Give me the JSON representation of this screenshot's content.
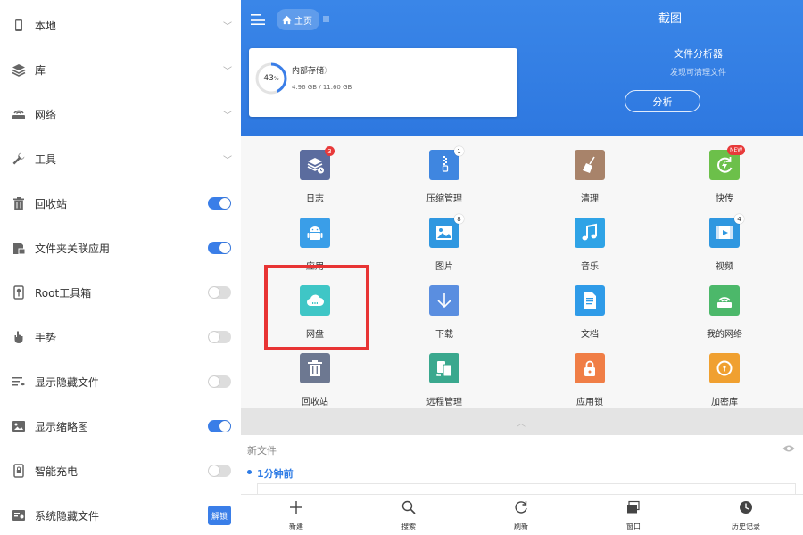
{
  "sidebar": {
    "items": [
      {
        "label": "本地",
        "icon": "phone-icon",
        "control": "chevron"
      },
      {
        "label": "库",
        "icon": "layers-icon",
        "control": "chevron"
      },
      {
        "label": "网络",
        "icon": "router-icon",
        "control": "chevron"
      },
      {
        "label": "工具",
        "icon": "wrench-icon",
        "control": "chevron"
      },
      {
        "label": "回收站",
        "icon": "trash-icon",
        "control": "toggle",
        "on": true
      },
      {
        "label": "文件夹关联应用",
        "icon": "folder-app-icon",
        "control": "toggle",
        "on": true
      },
      {
        "label": "Root工具箱",
        "icon": "root-icon",
        "control": "toggle",
        "on": false
      },
      {
        "label": "手势",
        "icon": "hand-icon",
        "control": "toggle",
        "on": false
      },
      {
        "label": "显示隐藏文件",
        "icon": "hidden-list-icon",
        "control": "toggle",
        "on": false
      },
      {
        "label": "显示缩略图",
        "icon": "thumbnail-icon",
        "control": "toggle",
        "on": true
      },
      {
        "label": "智能充电",
        "icon": "battery-lock-icon",
        "control": "toggle",
        "on": false
      },
      {
        "label": "系统隐藏文件",
        "icon": "system-file-icon",
        "control": "button",
        "button_label": "解锁"
      }
    ]
  },
  "header": {
    "home_label": "主页",
    "title": "截图"
  },
  "storage": {
    "percent_text": "43",
    "percent_unit": "%",
    "percent": 43,
    "name": "内部存储",
    "name_arrow": "〉",
    "size": "4.96 GB / 11.60 GB"
  },
  "analyzer": {
    "title": "文件分析器",
    "subtitle": "发现可清理文件",
    "button": "分析"
  },
  "tiles": [
    {
      "label": "日志",
      "icon": "log-icon",
      "color": "#5b6c9e",
      "badge": "3",
      "badge_style": "red"
    },
    {
      "label": "压缩管理",
      "icon": "zip-icon",
      "color": "#3f86e0",
      "badge": "1",
      "badge_style": "white"
    },
    {
      "label": "清理",
      "icon": "broom-icon",
      "color": "#a8836a",
      "badge": "",
      "badge_style": ""
    },
    {
      "label": "快传",
      "icon": "quick-send-icon",
      "color": "#6cc04a",
      "badge": "NEW",
      "badge_style": "new"
    },
    {
      "label": "应用",
      "icon": "android-icon",
      "color": "#3a9ee8",
      "badge": "",
      "badge_style": ""
    },
    {
      "label": "图片",
      "icon": "image-icon",
      "color": "#2f97e0",
      "badge": "8",
      "badge_style": "white"
    },
    {
      "label": "音乐",
      "icon": "music-icon",
      "color": "#2fa3e6",
      "badge": "",
      "badge_style": ""
    },
    {
      "label": "视频",
      "icon": "video-icon",
      "color": "#2f97e0",
      "badge": "4",
      "badge_style": "white"
    },
    {
      "label": "网盘",
      "icon": "cloud-icon",
      "color": "#3fc6c6",
      "badge": "",
      "badge_style": ""
    },
    {
      "label": "下载",
      "icon": "download-icon",
      "color": "#5a8ee0",
      "badge": "",
      "badge_style": ""
    },
    {
      "label": "文档",
      "icon": "document-icon",
      "color": "#2f9be8",
      "badge": "",
      "badge_style": ""
    },
    {
      "label": "我的网络",
      "icon": "network-icon",
      "color": "#4cb86a",
      "badge": "",
      "badge_style": ""
    },
    {
      "label": "回收站",
      "icon": "recycle-bin-icon",
      "color": "#6d7891",
      "badge": "",
      "badge_style": ""
    },
    {
      "label": "远程管理",
      "icon": "remote-icon",
      "color": "#3aa88e",
      "badge": "",
      "badge_style": ""
    },
    {
      "label": "应用锁",
      "icon": "app-lock-icon",
      "color": "#f07e46",
      "badge": "",
      "badge_style": ""
    },
    {
      "label": "加密库",
      "icon": "vault-icon",
      "color": "#f0a030",
      "badge": "",
      "badge_style": ""
    }
  ],
  "recent": {
    "title": "新文件",
    "time_group": "1分钟前"
  },
  "bottom_bar": [
    {
      "label": "新建",
      "icon": "plus-icon"
    },
    {
      "label": "搜索",
      "icon": "search-icon"
    },
    {
      "label": "刷新",
      "icon": "refresh-icon"
    },
    {
      "label": "窗口",
      "icon": "window-icon"
    },
    {
      "label": "历史记录",
      "icon": "clock-icon"
    }
  ],
  "colors": {
    "accent": "#3a7ee8",
    "header": "#3a86e8",
    "highlight": "#e83434"
  }
}
